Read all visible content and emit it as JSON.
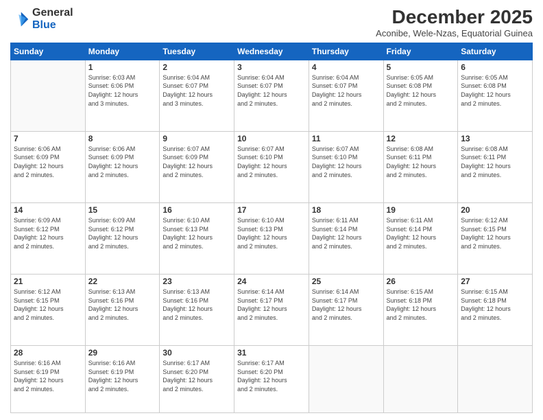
{
  "logo": {
    "general": "General",
    "blue": "Blue"
  },
  "header": {
    "month_title": "December 2025",
    "location": "Aconibe, Wele-Nzas, Equatorial Guinea"
  },
  "weekdays": [
    "Sunday",
    "Monday",
    "Tuesday",
    "Wednesday",
    "Thursday",
    "Friday",
    "Saturday"
  ],
  "weeks": [
    [
      {
        "day": "",
        "info": ""
      },
      {
        "day": "1",
        "info": "Sunrise: 6:03 AM\nSunset: 6:06 PM\nDaylight: 12 hours\nand 3 minutes."
      },
      {
        "day": "2",
        "info": "Sunrise: 6:04 AM\nSunset: 6:07 PM\nDaylight: 12 hours\nand 3 minutes."
      },
      {
        "day": "3",
        "info": "Sunrise: 6:04 AM\nSunset: 6:07 PM\nDaylight: 12 hours\nand 2 minutes."
      },
      {
        "day": "4",
        "info": "Sunrise: 6:04 AM\nSunset: 6:07 PM\nDaylight: 12 hours\nand 2 minutes."
      },
      {
        "day": "5",
        "info": "Sunrise: 6:05 AM\nSunset: 6:08 PM\nDaylight: 12 hours\nand 2 minutes."
      },
      {
        "day": "6",
        "info": "Sunrise: 6:05 AM\nSunset: 6:08 PM\nDaylight: 12 hours\nand 2 minutes."
      }
    ],
    [
      {
        "day": "7",
        "info": "Sunrise: 6:06 AM\nSunset: 6:09 PM\nDaylight: 12 hours\nand 2 minutes."
      },
      {
        "day": "8",
        "info": "Sunrise: 6:06 AM\nSunset: 6:09 PM\nDaylight: 12 hours\nand 2 minutes."
      },
      {
        "day": "9",
        "info": "Sunrise: 6:07 AM\nSunset: 6:09 PM\nDaylight: 12 hours\nand 2 minutes."
      },
      {
        "day": "10",
        "info": "Sunrise: 6:07 AM\nSunset: 6:10 PM\nDaylight: 12 hours\nand 2 minutes."
      },
      {
        "day": "11",
        "info": "Sunrise: 6:07 AM\nSunset: 6:10 PM\nDaylight: 12 hours\nand 2 minutes."
      },
      {
        "day": "12",
        "info": "Sunrise: 6:08 AM\nSunset: 6:11 PM\nDaylight: 12 hours\nand 2 minutes."
      },
      {
        "day": "13",
        "info": "Sunrise: 6:08 AM\nSunset: 6:11 PM\nDaylight: 12 hours\nand 2 minutes."
      }
    ],
    [
      {
        "day": "14",
        "info": "Sunrise: 6:09 AM\nSunset: 6:12 PM\nDaylight: 12 hours\nand 2 minutes."
      },
      {
        "day": "15",
        "info": "Sunrise: 6:09 AM\nSunset: 6:12 PM\nDaylight: 12 hours\nand 2 minutes."
      },
      {
        "day": "16",
        "info": "Sunrise: 6:10 AM\nSunset: 6:13 PM\nDaylight: 12 hours\nand 2 minutes."
      },
      {
        "day": "17",
        "info": "Sunrise: 6:10 AM\nSunset: 6:13 PM\nDaylight: 12 hours\nand 2 minutes."
      },
      {
        "day": "18",
        "info": "Sunrise: 6:11 AM\nSunset: 6:14 PM\nDaylight: 12 hours\nand 2 minutes."
      },
      {
        "day": "19",
        "info": "Sunrise: 6:11 AM\nSunset: 6:14 PM\nDaylight: 12 hours\nand 2 minutes."
      },
      {
        "day": "20",
        "info": "Sunrise: 6:12 AM\nSunset: 6:15 PM\nDaylight: 12 hours\nand 2 minutes."
      }
    ],
    [
      {
        "day": "21",
        "info": "Sunrise: 6:12 AM\nSunset: 6:15 PM\nDaylight: 12 hours\nand 2 minutes."
      },
      {
        "day": "22",
        "info": "Sunrise: 6:13 AM\nSunset: 6:16 PM\nDaylight: 12 hours\nand 2 minutes."
      },
      {
        "day": "23",
        "info": "Sunrise: 6:13 AM\nSunset: 6:16 PM\nDaylight: 12 hours\nand 2 minutes."
      },
      {
        "day": "24",
        "info": "Sunrise: 6:14 AM\nSunset: 6:17 PM\nDaylight: 12 hours\nand 2 minutes."
      },
      {
        "day": "25",
        "info": "Sunrise: 6:14 AM\nSunset: 6:17 PM\nDaylight: 12 hours\nand 2 minutes."
      },
      {
        "day": "26",
        "info": "Sunrise: 6:15 AM\nSunset: 6:18 PM\nDaylight: 12 hours\nand 2 minutes."
      },
      {
        "day": "27",
        "info": "Sunrise: 6:15 AM\nSunset: 6:18 PM\nDaylight: 12 hours\nand 2 minutes."
      }
    ],
    [
      {
        "day": "28",
        "info": "Sunrise: 6:16 AM\nSunset: 6:19 PM\nDaylight: 12 hours\nand 2 minutes."
      },
      {
        "day": "29",
        "info": "Sunrise: 6:16 AM\nSunset: 6:19 PM\nDaylight: 12 hours\nand 2 minutes."
      },
      {
        "day": "30",
        "info": "Sunrise: 6:17 AM\nSunset: 6:20 PM\nDaylight: 12 hours\nand 2 minutes."
      },
      {
        "day": "31",
        "info": "Sunrise: 6:17 AM\nSunset: 6:20 PM\nDaylight: 12 hours\nand 2 minutes."
      },
      {
        "day": "",
        "info": ""
      },
      {
        "day": "",
        "info": ""
      },
      {
        "day": "",
        "info": ""
      }
    ]
  ]
}
